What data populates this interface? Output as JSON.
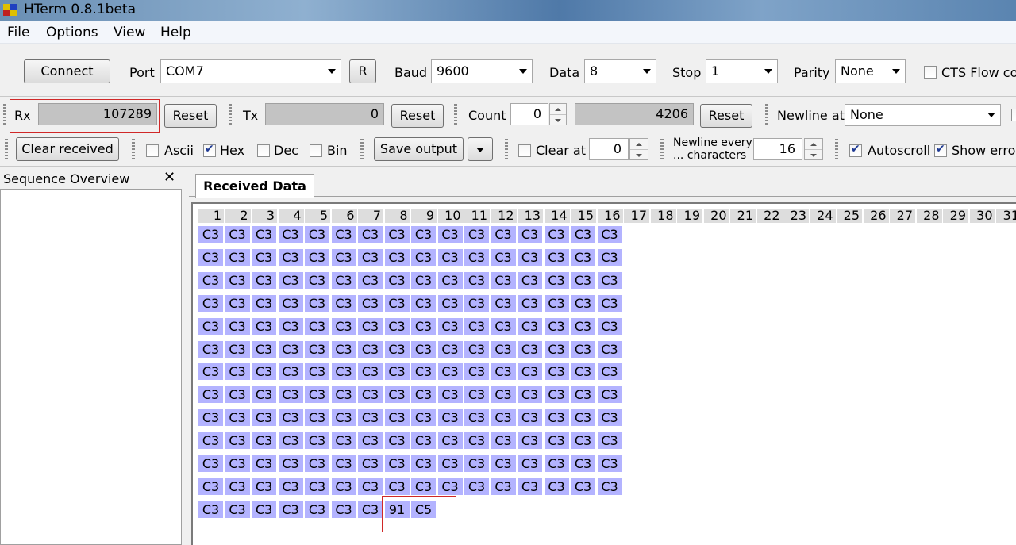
{
  "window": {
    "title": "HTerm 0.8.1beta"
  },
  "menu": [
    "File",
    "Options",
    "View",
    "Help"
  ],
  "connection": {
    "connect_label": "Connect",
    "port_label": "Port",
    "port_value": "COM7",
    "refresh_label": "R",
    "baud_label": "Baud",
    "baud_value": "9600",
    "data_label": "Data",
    "data_value": "8",
    "stop_label": "Stop",
    "stop_value": "1",
    "parity_label": "Parity",
    "parity_value": "None",
    "cts_label": "CTS Flow cor",
    "cts_checked": false
  },
  "counters": {
    "rx_label": "Rx",
    "rx_value": "107289",
    "rx_reset_label": "Reset",
    "tx_label": "Tx",
    "tx_value": "0",
    "tx_reset_label": "Reset",
    "count_label": "Count",
    "count_value": "0",
    "count_total": "4206",
    "count_reset_label": "Reset",
    "newline_label": "Newline at",
    "newline_value": "None"
  },
  "display": {
    "clear_received_label": "Clear received",
    "ascii_label": "Ascii",
    "ascii_checked": false,
    "hex_label": "Hex",
    "hex_checked": true,
    "dec_label": "Dec",
    "dec_checked": false,
    "bin_label": "Bin",
    "bin_checked": false,
    "save_output_label": "Save output",
    "clear_at_label": "Clear at",
    "clear_at_checked": false,
    "clear_at_value": "0",
    "newline_every_label_1": "Newline every",
    "newline_every_label_2": "... characters",
    "newline_every_value": "16",
    "autoscroll_label": "Autoscroll",
    "autoscroll_checked": true,
    "show_errors_label": "Show error",
    "show_errors_checked": true
  },
  "sequence_overview": {
    "title": "Sequence Overview"
  },
  "received": {
    "tab_label": "Received Data",
    "columns": [
      "1",
      "2",
      "3",
      "4",
      "5",
      "6",
      "7",
      "8",
      "9",
      "10",
      "11",
      "12",
      "13",
      "14",
      "15",
      "16",
      "17",
      "18",
      "19",
      "20",
      "21",
      "22",
      "23",
      "24",
      "25",
      "26",
      "27",
      "28",
      "29",
      "30",
      "31"
    ],
    "full_rows": 12,
    "fill_value": "C3",
    "last_row": [
      "C3",
      "C3",
      "C3",
      "C3",
      "C3",
      "C3",
      "C3",
      "91",
      "C5"
    ]
  },
  "colors": {
    "byte_cell": "#b3b3ff",
    "highlight": "#d02828"
  }
}
